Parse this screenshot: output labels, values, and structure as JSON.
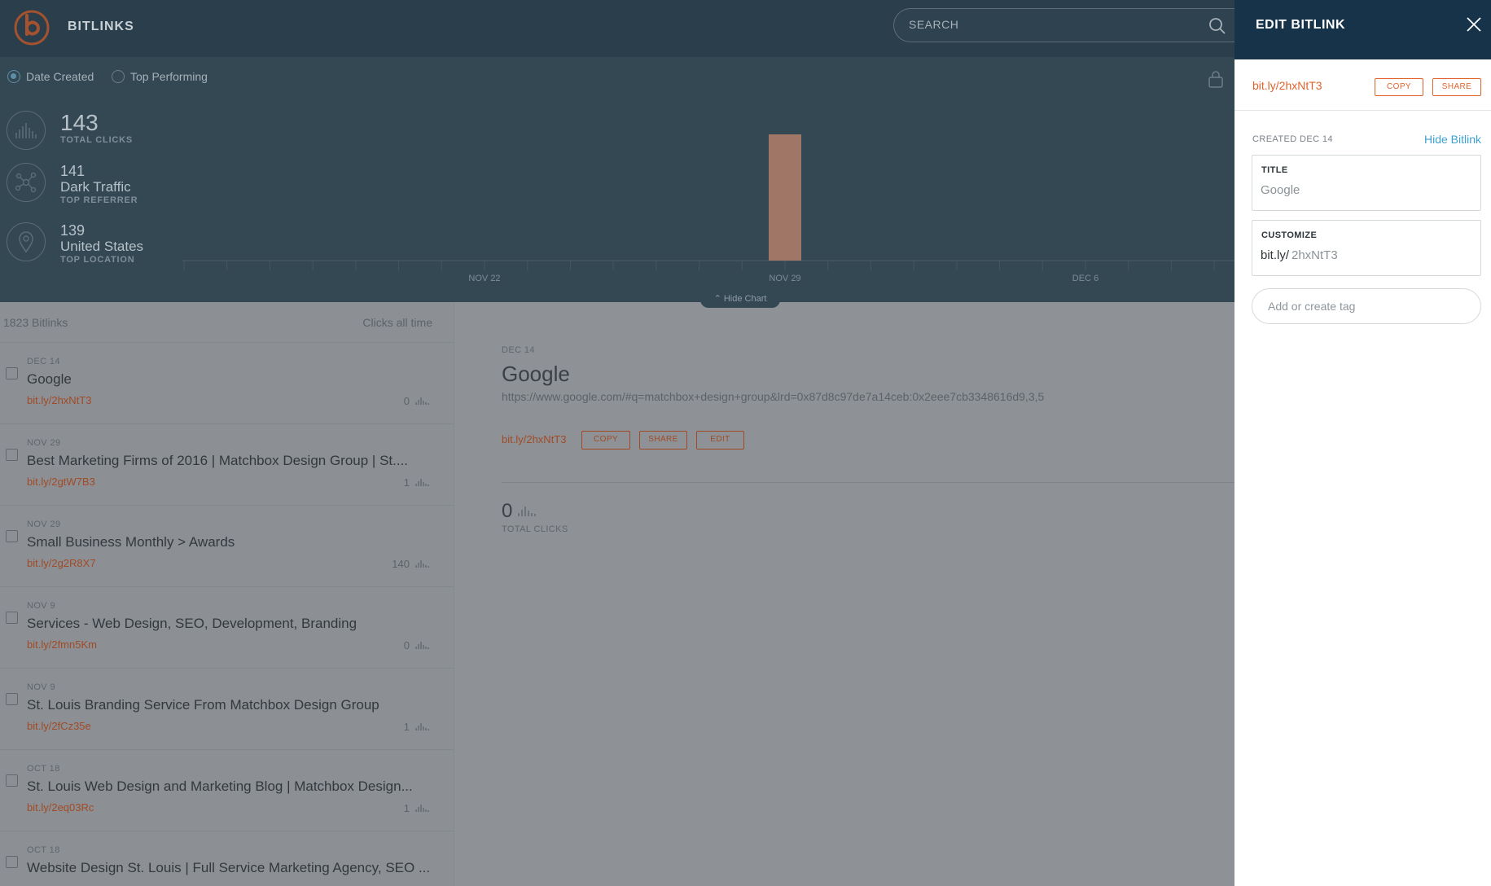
{
  "app": {
    "title": "BITLINKS"
  },
  "search": {
    "placeholder": "SEARCH"
  },
  "sort": {
    "date_created": "Date Created",
    "top_performing": "Top Performing"
  },
  "stats": {
    "total_clicks": {
      "value": "143",
      "label": "TOTAL CLICKS"
    },
    "top_referrer": {
      "value": "141",
      "name": "Dark Traffic",
      "label": "TOP REFERRER"
    },
    "top_location": {
      "value": "139",
      "name": "United States",
      "label": "TOP LOCATION"
    }
  },
  "chart_data": {
    "type": "bar",
    "x_tick_labels": [
      "NOV 22",
      "NOV 29",
      "DEC 6"
    ],
    "bars": [
      {
        "x": "NOV 29",
        "value": 141
      }
    ],
    "grid": false
  },
  "hide_chart_label": "Hide Chart",
  "list": {
    "count_label": "1823 Bitlinks",
    "sort_label": "Clicks all time",
    "items": [
      {
        "date": "DEC 14",
        "title": "Google",
        "link": "bit.ly/2hxNtT3",
        "clicks": "0"
      },
      {
        "date": "NOV 29",
        "title": "Best Marketing Firms of 2016 | Matchbox Design Group | St....",
        "link": "bit.ly/2gtW7B3",
        "clicks": "1"
      },
      {
        "date": "NOV 29",
        "title": "Small Business Monthly > Awards",
        "link": "bit.ly/2g2R8X7",
        "clicks": "140"
      },
      {
        "date": "NOV 9",
        "title": "Services - Web Design, SEO, Development, Branding",
        "link": "bit.ly/2fmn5Km",
        "clicks": "0"
      },
      {
        "date": "NOV 9",
        "title": "St. Louis Branding Service From Matchbox Design Group",
        "link": "bit.ly/2fCz35e",
        "clicks": "1"
      },
      {
        "date": "OCT 18",
        "title": "St. Louis Web Design and Marketing Blog | Matchbox Design...",
        "link": "bit.ly/2eq03Rc",
        "clicks": "1"
      },
      {
        "date": "OCT 18",
        "title": "Website Design St. Louis | Full Service Marketing Agency, SEO ...",
        "link": "",
        "clicks": ""
      }
    ]
  },
  "detail": {
    "date": "DEC 14",
    "title": "Google",
    "url": "https://www.google.com/#q=matchbox+design+group&lrd=0x87d8c97de7a14ceb:0x2eee7cb3348616d9,3,5",
    "link": "bit.ly/2hxNtT3",
    "copy": "COPY",
    "share": "SHARE",
    "edit": "EDIT",
    "clicks": "0",
    "clicks_label": "TOTAL CLICKS"
  },
  "edit_panel": {
    "title": "EDIT BITLINK",
    "link": "bit.ly/2hxNtT3",
    "copy": "COPY",
    "share": "SHARE",
    "created": "CREATED DEC 14",
    "hide_bitlink": "Hide Bitlink",
    "title_label": "TITLE",
    "title_value": "Google",
    "customize_label": "CUSTOMIZE",
    "customize_prefix": "bit.ly/",
    "customize_value": "2hxNtT3",
    "tag_placeholder": "Add or create tag"
  },
  "colors": {
    "accent": "#e0632c",
    "header": "#16334a",
    "link_blue": "#3ea1d3"
  }
}
